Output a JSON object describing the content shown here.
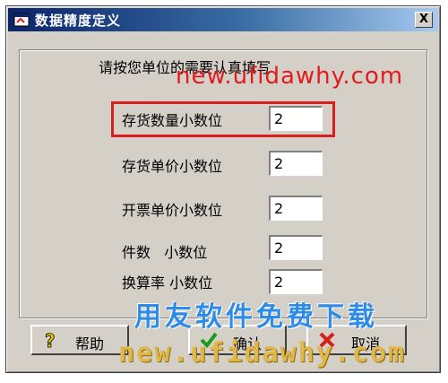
{
  "window": {
    "title": "数据精度定义",
    "close_label": "X"
  },
  "instruction": "请按您单位的需要认真填写",
  "rows": [
    {
      "label": "存货数量小数位",
      "value": "2"
    },
    {
      "label": "存货单价小数位",
      "value": "2"
    },
    {
      "label": "开票单价小数位",
      "value": "2"
    },
    {
      "label": "件数   小数位",
      "value": "2"
    },
    {
      "label": "换算率 小数位",
      "value": "2"
    }
  ],
  "buttons": {
    "help": {
      "label": "帮助",
      "icon": "question-icon"
    },
    "ok": {
      "label": "确认",
      "icon": "checkmark-icon"
    },
    "cancel": {
      "label": "取消",
      "icon": "cancel-x-icon"
    }
  },
  "watermarks": {
    "top": "new.ufidawhy.com",
    "cn": "用友软件免费下载",
    "bottom": "new.ufidawhy.com"
  },
  "colors": {
    "highlight": "#d81e1e",
    "title_bar": "#0a246a",
    "dialog_bg": "#d4d0c8"
  }
}
